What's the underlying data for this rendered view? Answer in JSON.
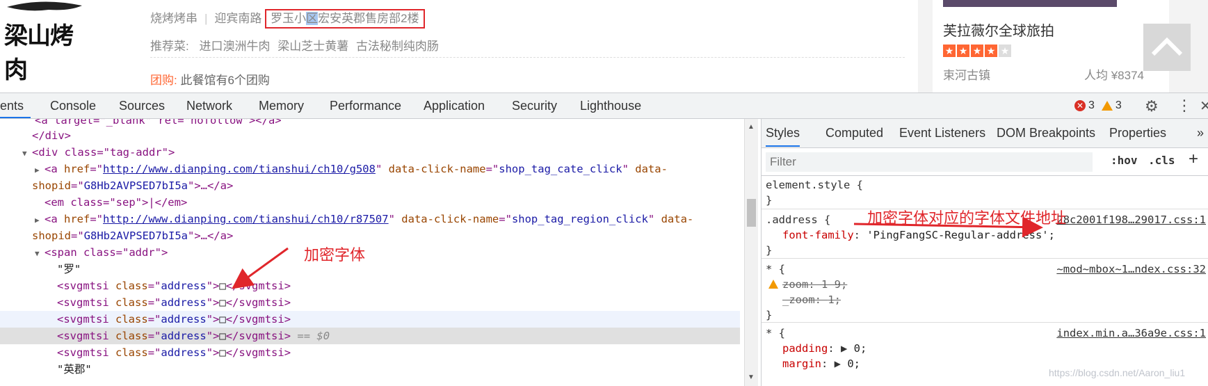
{
  "shop": {
    "logo_text": "梁山烤肉",
    "category": "烧烤烤串",
    "region": "迎宾南路",
    "address_prefix": "罗玉小",
    "address_highlight": "区",
    "address_rest": "宏安英郡售房部2楼",
    "recommend_label": "推荐菜:",
    "dishes": [
      "进口澳洲牛肉",
      "梁山芝士黄薯",
      "古法秘制纯肉肠"
    ],
    "tuan_label": "团购:",
    "tuan_text": "此餐馆有6个团购"
  },
  "card": {
    "title": "芙拉薇尔全球旅拍",
    "rating_stars": 4,
    "rating_max": 5,
    "location": "束河古镇",
    "price": "人均 ¥8374"
  },
  "devtools": {
    "tabs": [
      "ents",
      "Console",
      "Sources",
      "Network",
      "Memory",
      "Performance",
      "Application",
      "Security",
      "Lighthouse"
    ],
    "error_count": "3",
    "warning_count": "3",
    "elements": {
      "lines": [
        {
          "text": "</div>"
        },
        {
          "text": "<div class=\"tag-addr\">"
        },
        {
          "href": "http://www.dianping.com/tianshui/ch10/g508",
          "click_name": "shop_tag_cate_click",
          "shopid": "G8Hb2AVPSED7bI5a"
        },
        {
          "text": "<em class=\"sep\">|</em>"
        },
        {
          "href": "http://www.dianping.com/tianshui/ch10/r87507",
          "click_name": "shop_tag_region_click",
          "shopid": "G8Hb2AVPSED7bI5a"
        },
        {
          "text": "<span class=\"addr\">"
        },
        {
          "text": "\"罗\""
        },
        {
          "text": "\"英郡\""
        }
      ],
      "svg_tag": "svgmtsi",
      "svg_class": "address",
      "glyph": "□",
      "selected_marker": "== $0"
    },
    "styles": {
      "tabs": [
        "Styles",
        "Computed",
        "Event Listeners",
        "DOM Breakpoints",
        "Properties"
      ],
      "filter_placeholder": "Filter",
      "hov": ":hov",
      "cls": ".cls",
      "rules": [
        {
          "selector": "element.style {"
        },
        {
          "selector": ".address {",
          "source": "28c2001f198…29017.css:1",
          "prop": "font-family",
          "value": "'PingFangSC-Regular-address';"
        },
        {
          "selector": "* {",
          "source": "~mod~mbox~1…ndex.css:32",
          "prop1": "zoom",
          "val1": "1 9;",
          "prop2": "_zoom",
          "val2": "1;"
        },
        {
          "selector": "* {",
          "source": "index.min.a…36a9e.css:1",
          "prop1": "padding",
          "val1": "0;",
          "prop2": "margin",
          "val2": "0;"
        }
      ]
    }
  },
  "annotations": {
    "encrypted_font": "加密字体",
    "font_file_url": "加密字体对应的字体文件地址"
  },
  "watermark": "https://blog.csdn.net/Aaron_liu1",
  "colors": {
    "annotation": "#e0262b",
    "devtools_blue": "#1a73e8",
    "tag": "#881280"
  }
}
